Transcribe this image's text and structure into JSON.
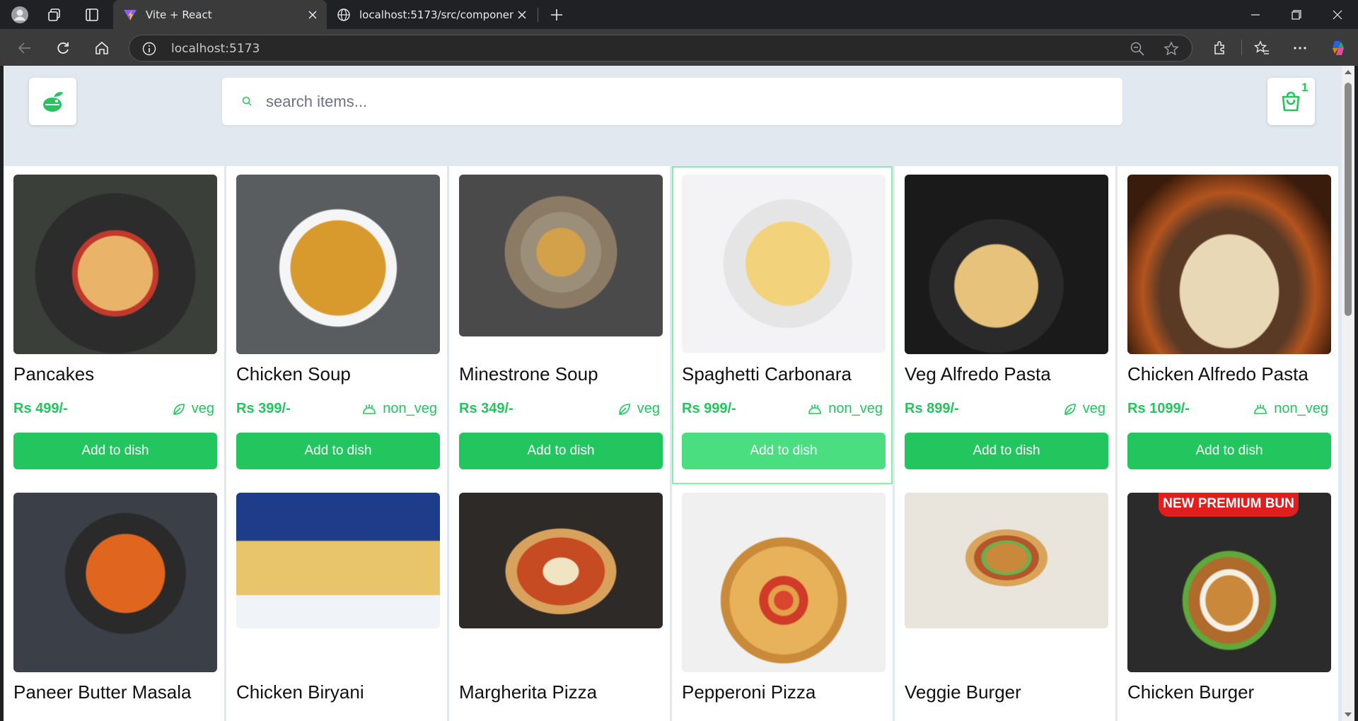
{
  "browser": {
    "tabs": [
      {
        "title": "Vite + React",
        "active": true
      },
      {
        "title": "localhost:5173/src/components/C",
        "active": false
      }
    ],
    "url": "localhost:5173"
  },
  "header": {
    "search_placeholder": "search items...",
    "cart_count": "1"
  },
  "menu": [
    {
      "name": "Pancakes",
      "price": "Rs 499/-",
      "type": "veg",
      "button": "Add to dish"
    },
    {
      "name": "Chicken Soup",
      "price": "Rs 399/-",
      "type": "non_veg",
      "button": "Add to dish"
    },
    {
      "name": "Minestrone Soup",
      "price": "Rs 349/-",
      "type": "veg",
      "button": "Add to dish"
    },
    {
      "name": "Spaghetti Carbonara",
      "price": "Rs 999/-",
      "type": "non_veg",
      "button": "Add to dish"
    },
    {
      "name": "Veg Alfredo Pasta",
      "price": "Rs 899/-",
      "type": "veg",
      "button": "Add to dish"
    },
    {
      "name": "Chicken Alfredo Pasta",
      "price": "Rs 1099/-",
      "type": "non_veg",
      "button": "Add to dish"
    },
    {
      "name": "Paneer Butter Masala"
    },
    {
      "name": "Chicken Biryani"
    },
    {
      "name": "Margherita Pizza"
    },
    {
      "name": "Pepperoni Pizza"
    },
    {
      "name": "Veggie Burger"
    },
    {
      "name": "Chicken Burger",
      "image_banner": "NEW PREMIUM BUN"
    }
  ],
  "colors": {
    "accent": "#22c55e",
    "accent_hover": "#4ade80",
    "page_bg": "#e2e8f0"
  },
  "icons": [
    "profile-icon",
    "workspaces-icon",
    "tab-actions-icon",
    "close-icon",
    "back-icon",
    "reload-icon",
    "home-icon",
    "info-icon",
    "zoom-icon",
    "favorite-star-icon",
    "extensions-icon",
    "favorites-icon",
    "more-icon",
    "copilot-icon",
    "logo-icon",
    "search-icon",
    "cart-icon",
    "leaf-icon",
    "chicken-icon"
  ]
}
